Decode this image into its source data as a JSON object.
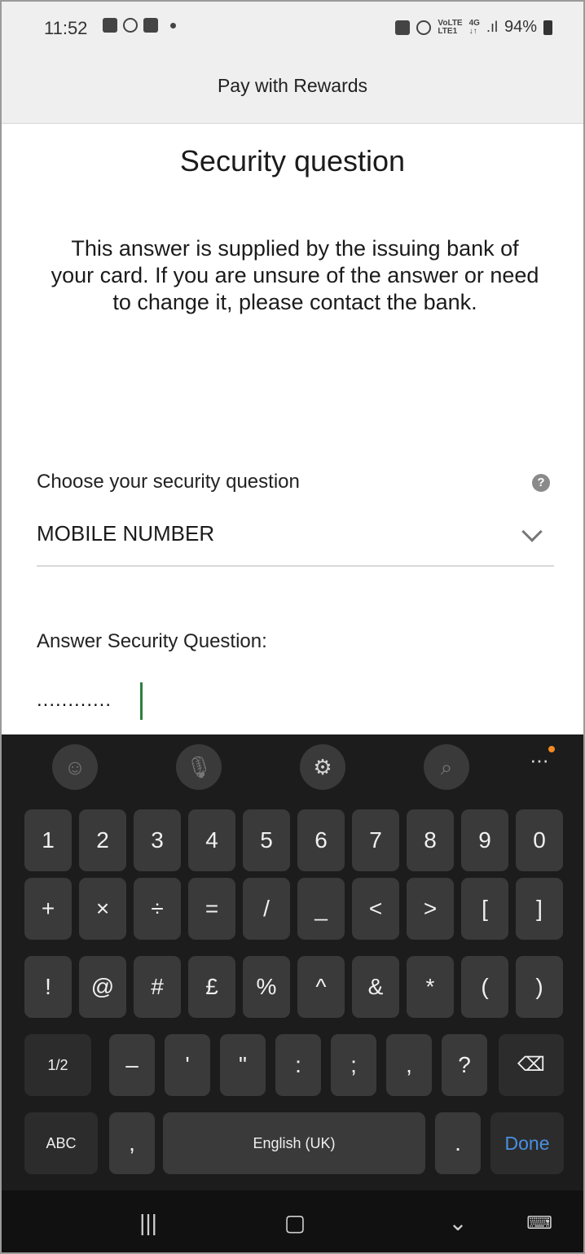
{
  "status_bar": {
    "time": "11:52",
    "network_label_top": "VoLTE",
    "network_label_bottom": "LTE1",
    "data_label_top": "4G",
    "data_label_bottom": "↓↑",
    "battery": "94%"
  },
  "header": {
    "title": "Pay with Rewards"
  },
  "content": {
    "title": "Security question",
    "info": "This answer is supplied by the issuing bank of your card. If you are unsure of the answer or need to change it, please contact the bank.",
    "question_label": "Choose your security question",
    "question_value": "MOBILE NUMBER",
    "answer_label": "Answer Security Question:",
    "answer_value": "............"
  },
  "keyboard": {
    "toolbar": [
      "emoji-icon",
      "mic-icon",
      "settings-icon",
      "search-icon",
      "more-icon"
    ],
    "row1": [
      "1",
      "2",
      "3",
      "4",
      "5",
      "6",
      "7",
      "8",
      "9",
      "0"
    ],
    "row2": [
      "+",
      "×",
      "÷",
      "=",
      "/",
      "_",
      "<",
      ">",
      "[",
      "]"
    ],
    "row3": [
      "!",
      "@",
      "#",
      "£",
      "%",
      "^",
      "&",
      "*",
      "(",
      ")"
    ],
    "row4": [
      "1/2",
      "–",
      "'",
      "\"",
      ":",
      ";",
      ",",
      "?"
    ],
    "row5": {
      "abc": "ABC",
      "comma": ",",
      "space": "English (UK)",
      "period": ".",
      "done": "Done"
    }
  },
  "colors": {
    "caret": "#2f7d3f",
    "done_key": "#4a90e2",
    "notification_badge": "#f28a22"
  }
}
